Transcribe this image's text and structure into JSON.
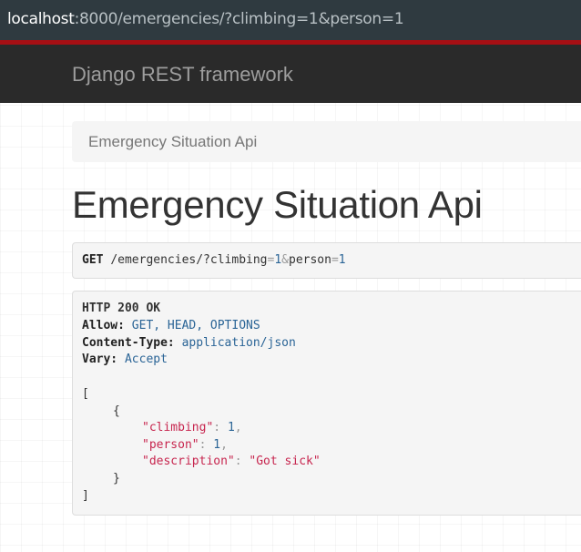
{
  "browser": {
    "url_host": "localhost",
    "url_path": ":8000/emergencies/?climbing=1&person=1"
  },
  "navbar": {
    "brand": "Django REST framework"
  },
  "breadcrumb": {
    "item": "Emergency Situation Api"
  },
  "page": {
    "title": "Emergency Situation Api"
  },
  "request": {
    "method": "GET",
    "path_prefix": "/emergencies/?",
    "param1_key": "climbing",
    "param1_value": "1",
    "amp": "&",
    "param2_key": "person",
    "param2_value": "1",
    "eq": "="
  },
  "response": {
    "status": "HTTP 200 OK",
    "allow_label": "Allow:",
    "allow_value": "GET, HEAD, OPTIONS",
    "content_type_label": "Content-Type:",
    "content_type_value": "application/json",
    "vary_label": "Vary:",
    "vary_value": "Accept",
    "body": {
      "open_bracket": "[",
      "open_brace": "{",
      "close_brace": "}",
      "close_bracket": "]",
      "field_climbing_key": "\"climbing\"",
      "field_climbing_value": "1",
      "field_person_key": "\"person\"",
      "field_person_value": "1",
      "field_description_key": "\"description\"",
      "field_description_value": "\"Got sick\"",
      "colon": ": ",
      "comma": ","
    }
  },
  "colors": {
    "navbar_bg": "#2a2a2a",
    "accent_red": "#a60f14",
    "key_red": "#c7254e",
    "link_blue": "#2a6496"
  }
}
